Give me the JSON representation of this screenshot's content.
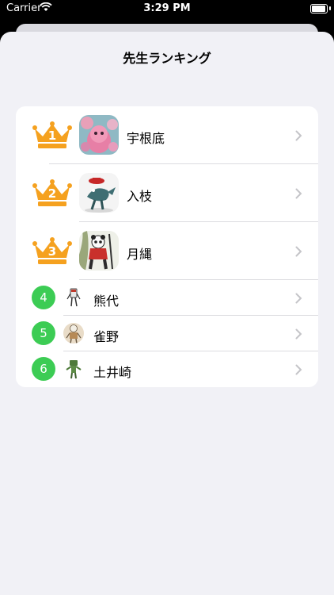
{
  "status_bar": {
    "carrier": "Carrier",
    "time": "3:29 PM"
  },
  "title": "先生ランキング",
  "colors": {
    "crown": "#f5a11f",
    "badge": "#3ccc54",
    "sheet_bg": "#f1f1f6"
  },
  "ranking": [
    {
      "rank": "1",
      "name": "宇根底",
      "avatar": "pink-creature-avatar"
    },
    {
      "rank": "2",
      "name": "入枝",
      "avatar": "shark-hat-avatar"
    },
    {
      "rank": "3",
      "name": "月縄",
      "avatar": "panda-avatar"
    },
    {
      "rank": "4",
      "name": "熊代",
      "avatar": "robot-avatar"
    },
    {
      "rank": "5",
      "name": "雀野",
      "avatar": "skeleton-avatar"
    },
    {
      "rank": "6",
      "name": "土井崎",
      "avatar": "green-robot-avatar"
    }
  ]
}
